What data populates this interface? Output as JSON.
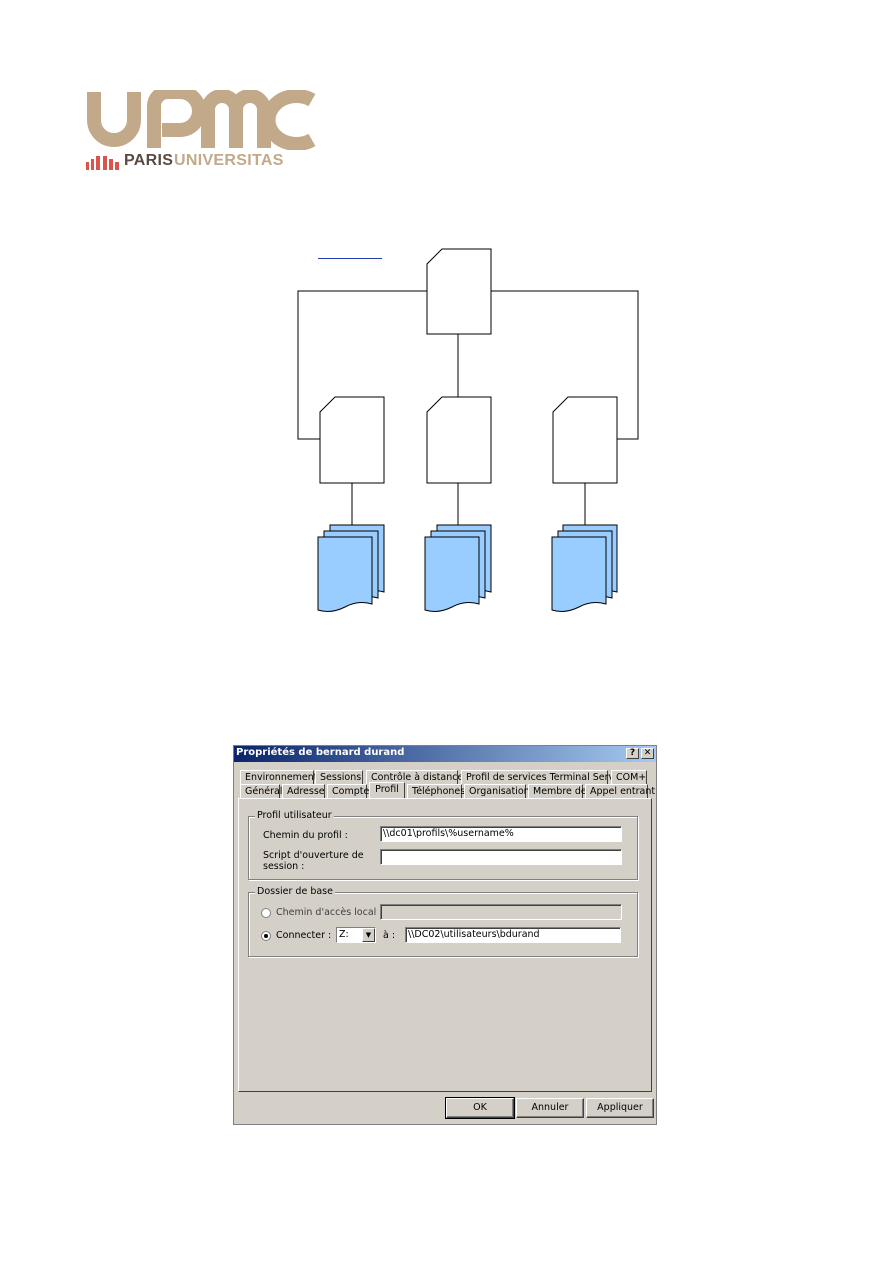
{
  "logo": {
    "wordmark": "UPMC",
    "tagline_part1": "PARIS",
    "tagline_part2": "UNIVERSITAS",
    "colors": {
      "wordmark": "#c2a98a",
      "paris": "#5a4a42",
      "universitas": "#c2a98a",
      "bars": "#d9534f"
    }
  },
  "diagram": {
    "colors": {
      "box_fill": "#ffffff",
      "stroke": "#000000",
      "doc_fill": "#99ccff"
    }
  },
  "dialog": {
    "title": "Propriétés de bernard durand",
    "help_btn": "?",
    "close_btn": "✕",
    "tabs_row1": [
      "Environnement",
      "Sessions",
      "Contrôle à distance",
      "Profil de services Terminal Server",
      "COM+"
    ],
    "tabs_row2": [
      "Général",
      "Adresse",
      "Compte",
      "Profil",
      "Téléphones",
      "Organisation",
      "Membre de",
      "Appel entrant"
    ],
    "active_tab": "Profil",
    "profile_group": {
      "legend": "Profil utilisateur",
      "path_label": "Chemin du profil :",
      "path_value": "\\\\dc01\\profils\\%username%",
      "script_label_1": "Script d'ouverture de",
      "script_label_2": "session :",
      "script_value": ""
    },
    "home_group": {
      "legend": "Dossier de base",
      "local_label": "Chemin d'accès local :",
      "local_value": "",
      "connect_label": "Connecter :",
      "drive_value": "Z:",
      "to_label": "à :",
      "connect_value": "\\\\DC02\\utilisateurs\\bdurand"
    },
    "buttons": {
      "ok": "OK",
      "cancel": "Annuler",
      "apply": "Appliquer"
    }
  }
}
